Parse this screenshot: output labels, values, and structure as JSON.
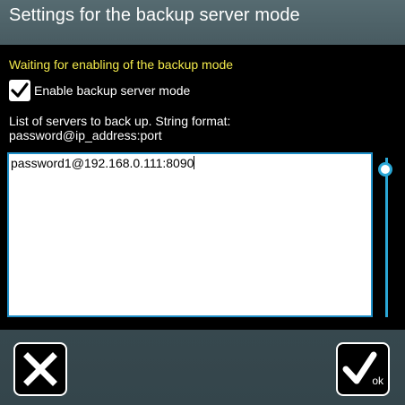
{
  "dialog": {
    "title": "Settings for the backup server mode"
  },
  "status": {
    "text": "Waiting for enabling of the backup mode",
    "color": "#f2e94b"
  },
  "backup_mode": {
    "label": "Enable backup server mode",
    "checked": true
  },
  "server_list": {
    "description_line1": "List of servers to back up. String format:",
    "description_line2": "password@ip_address:port",
    "value": "password1@192.168.0.111:8090"
  },
  "buttons": {
    "cancel_icon": "close-icon",
    "ok_icon": "checkmark-icon",
    "ok_label": "ok"
  },
  "colors": {
    "accent": "#2aa7d6",
    "panel_background": "#000000",
    "title_background": "#4f6268"
  }
}
